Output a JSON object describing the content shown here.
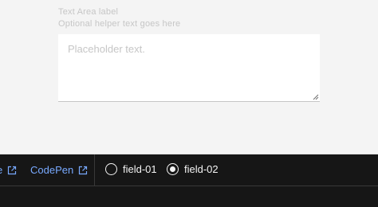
{
  "textarea": {
    "label": "Text Area label",
    "helper": "Optional helper text goes here",
    "placeholder": "Placeholder text.",
    "value": ""
  },
  "toolbar": {
    "links": [
      {
        "label": "e",
        "icon": "external-link-icon"
      },
      {
        "label": "CodePen",
        "icon": "external-link-icon"
      }
    ],
    "radios": [
      {
        "label": "field-01",
        "checked": false
      },
      {
        "label": "field-02",
        "checked": true
      }
    ]
  },
  "colors": {
    "link": "#78a9ff",
    "toolbar_bg": "#161616",
    "preview_bg": "#f4f4f4"
  }
}
